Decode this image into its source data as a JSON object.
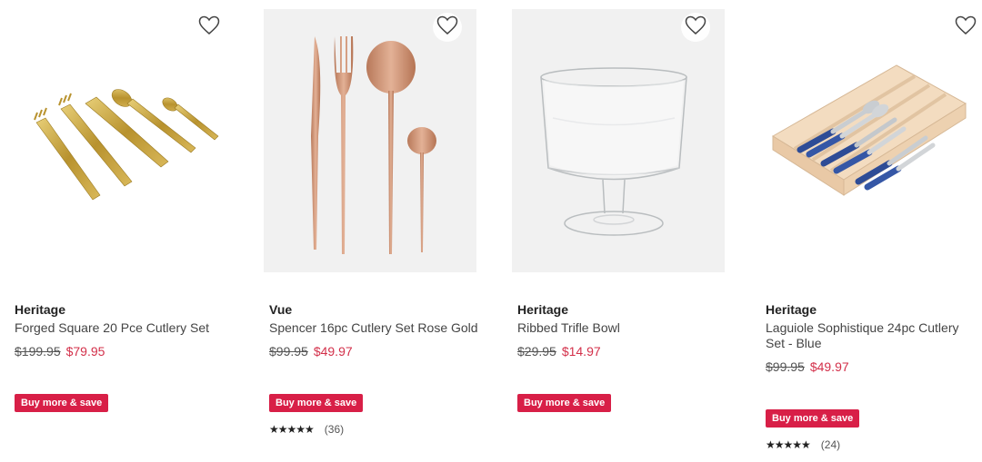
{
  "products": [
    {
      "brand": "Heritage",
      "title": "Forged Square 20 Pce Cutlery Set",
      "was_price": "$199.95",
      "now_price": "$79.95",
      "promo": "Buy more & save",
      "image_bg": "white"
    },
    {
      "brand": "Vue",
      "title": "Spencer 16pc Cutlery Set Rose Gold",
      "was_price": "$99.95",
      "now_price": "$49.97",
      "promo": "Buy more & save",
      "stars": "★★★★★",
      "rating_value": 4.5,
      "review_count": "(36)",
      "image_bg": "grey"
    },
    {
      "brand": "Heritage",
      "title": "Ribbed Trifle Bowl",
      "was_price": "$29.95",
      "now_price": "$14.97",
      "promo": "Buy more & save",
      "image_bg": "grey"
    },
    {
      "brand": "Heritage",
      "title": "Laguiole Sophistique 24pc Cutlery Set - Blue",
      "was_price": "$99.95",
      "now_price": "$49.97",
      "promo": "Buy more & save",
      "stars": "★★★★★",
      "rating_value": 4.5,
      "review_count": "(24)",
      "image_bg": "white"
    }
  ],
  "icons": {
    "wishlist": "heart-outline-icon",
    "star": "star-icon"
  },
  "colors": {
    "sale_price": "#d3304a",
    "promo_badge": "#d81f47",
    "image_grey": "#f1f1f1"
  }
}
